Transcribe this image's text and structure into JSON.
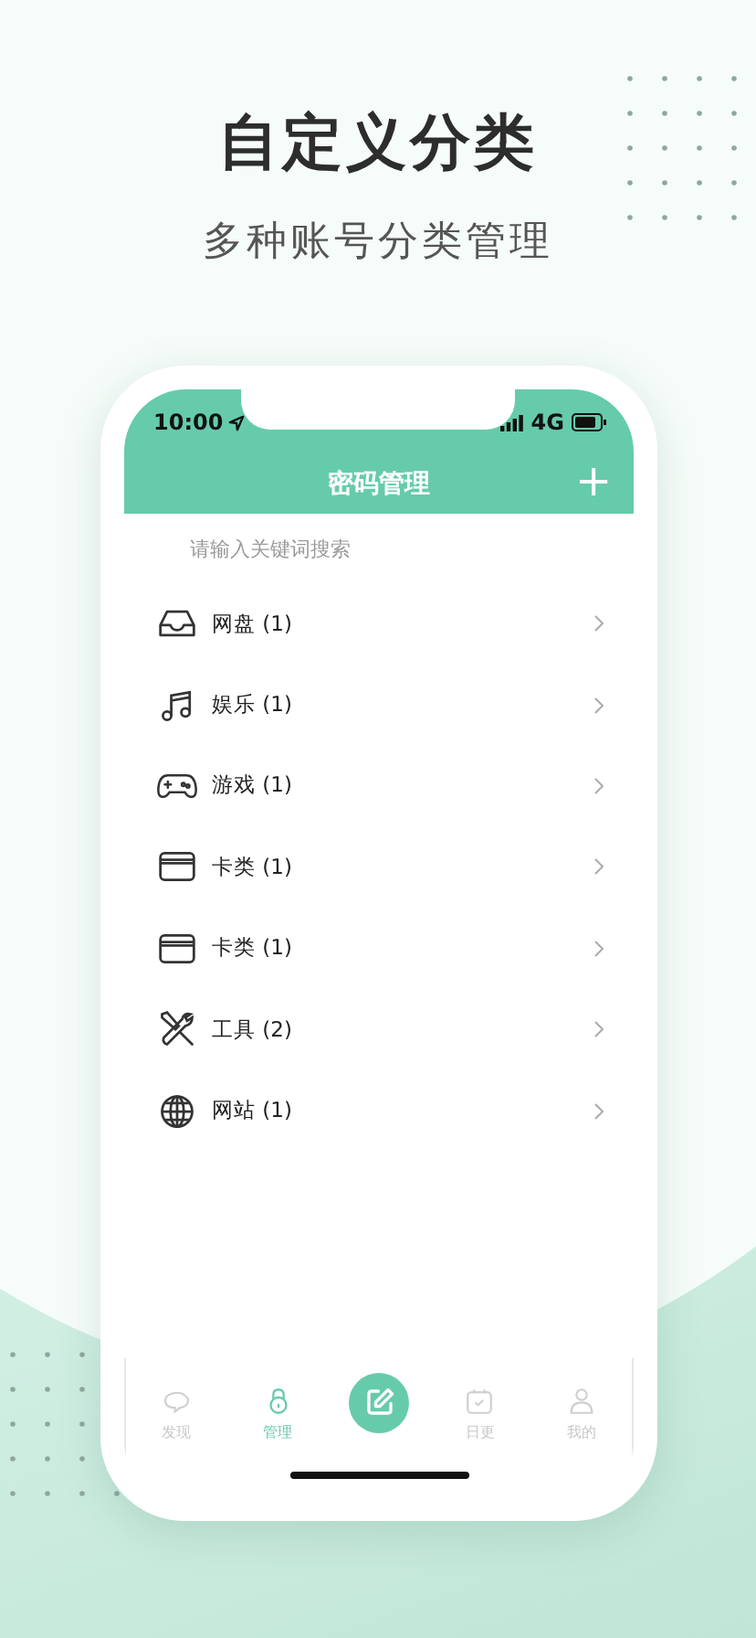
{
  "headline": "自定义分类",
  "subtitle": "多种账号分类管理",
  "status_bar": {
    "time": "10:00",
    "network": "4G"
  },
  "nav_bar": {
    "title": "密码管理",
    "action": "+"
  },
  "search": {
    "placeholder": "请输入关键词搜索"
  },
  "categories": [
    {
      "kind": "inbox",
      "label": "网盘 (1)"
    },
    {
      "kind": "music",
      "label": "娱乐 (1)"
    },
    {
      "kind": "gamepad",
      "label": "游戏 (1)"
    },
    {
      "kind": "card",
      "label": "卡类 (1)"
    },
    {
      "kind": "card",
      "label": "卡类 (1)"
    },
    {
      "kind": "tools",
      "label": "工具 (2)"
    },
    {
      "kind": "globe",
      "label": "网站 (1)"
    }
  ],
  "tab_bar": [
    {
      "kind": "chat",
      "label": "发现",
      "selected": false
    },
    {
      "kind": "lock",
      "label": "管理",
      "selected": true
    },
    {
      "kind": "compose"
    },
    {
      "kind": "calendar",
      "label": "日更",
      "selected": false
    },
    {
      "kind": "person",
      "label": "我的",
      "selected": false
    }
  ]
}
